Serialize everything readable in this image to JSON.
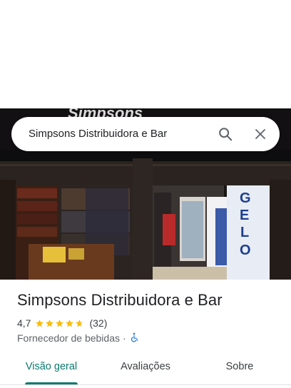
{
  "search": {
    "query": "Simpsons Distribuidora e Bar",
    "search_icon": "search-icon",
    "close_icon": "close-icon"
  },
  "photo": {
    "storefront_sign": "GELO",
    "banner_text": "Simpsons"
  },
  "place": {
    "name": "Simpsons Distribuidora e Bar",
    "rating": "4,7",
    "rating_fraction": 0.94,
    "review_count": "(32)",
    "category": "Fornecedor de bebidas",
    "separator": "·",
    "accessibility_icon": "wheelchair-icon"
  },
  "tabs": [
    {
      "label": "Visão geral",
      "active": true
    },
    {
      "label": "Avaliações",
      "active": false
    },
    {
      "label": "Sobre",
      "active": false
    }
  ],
  "colors": {
    "accent": "#0b7a6f",
    "star": "#fbbc04",
    "accessibility": "#1a73e8"
  }
}
